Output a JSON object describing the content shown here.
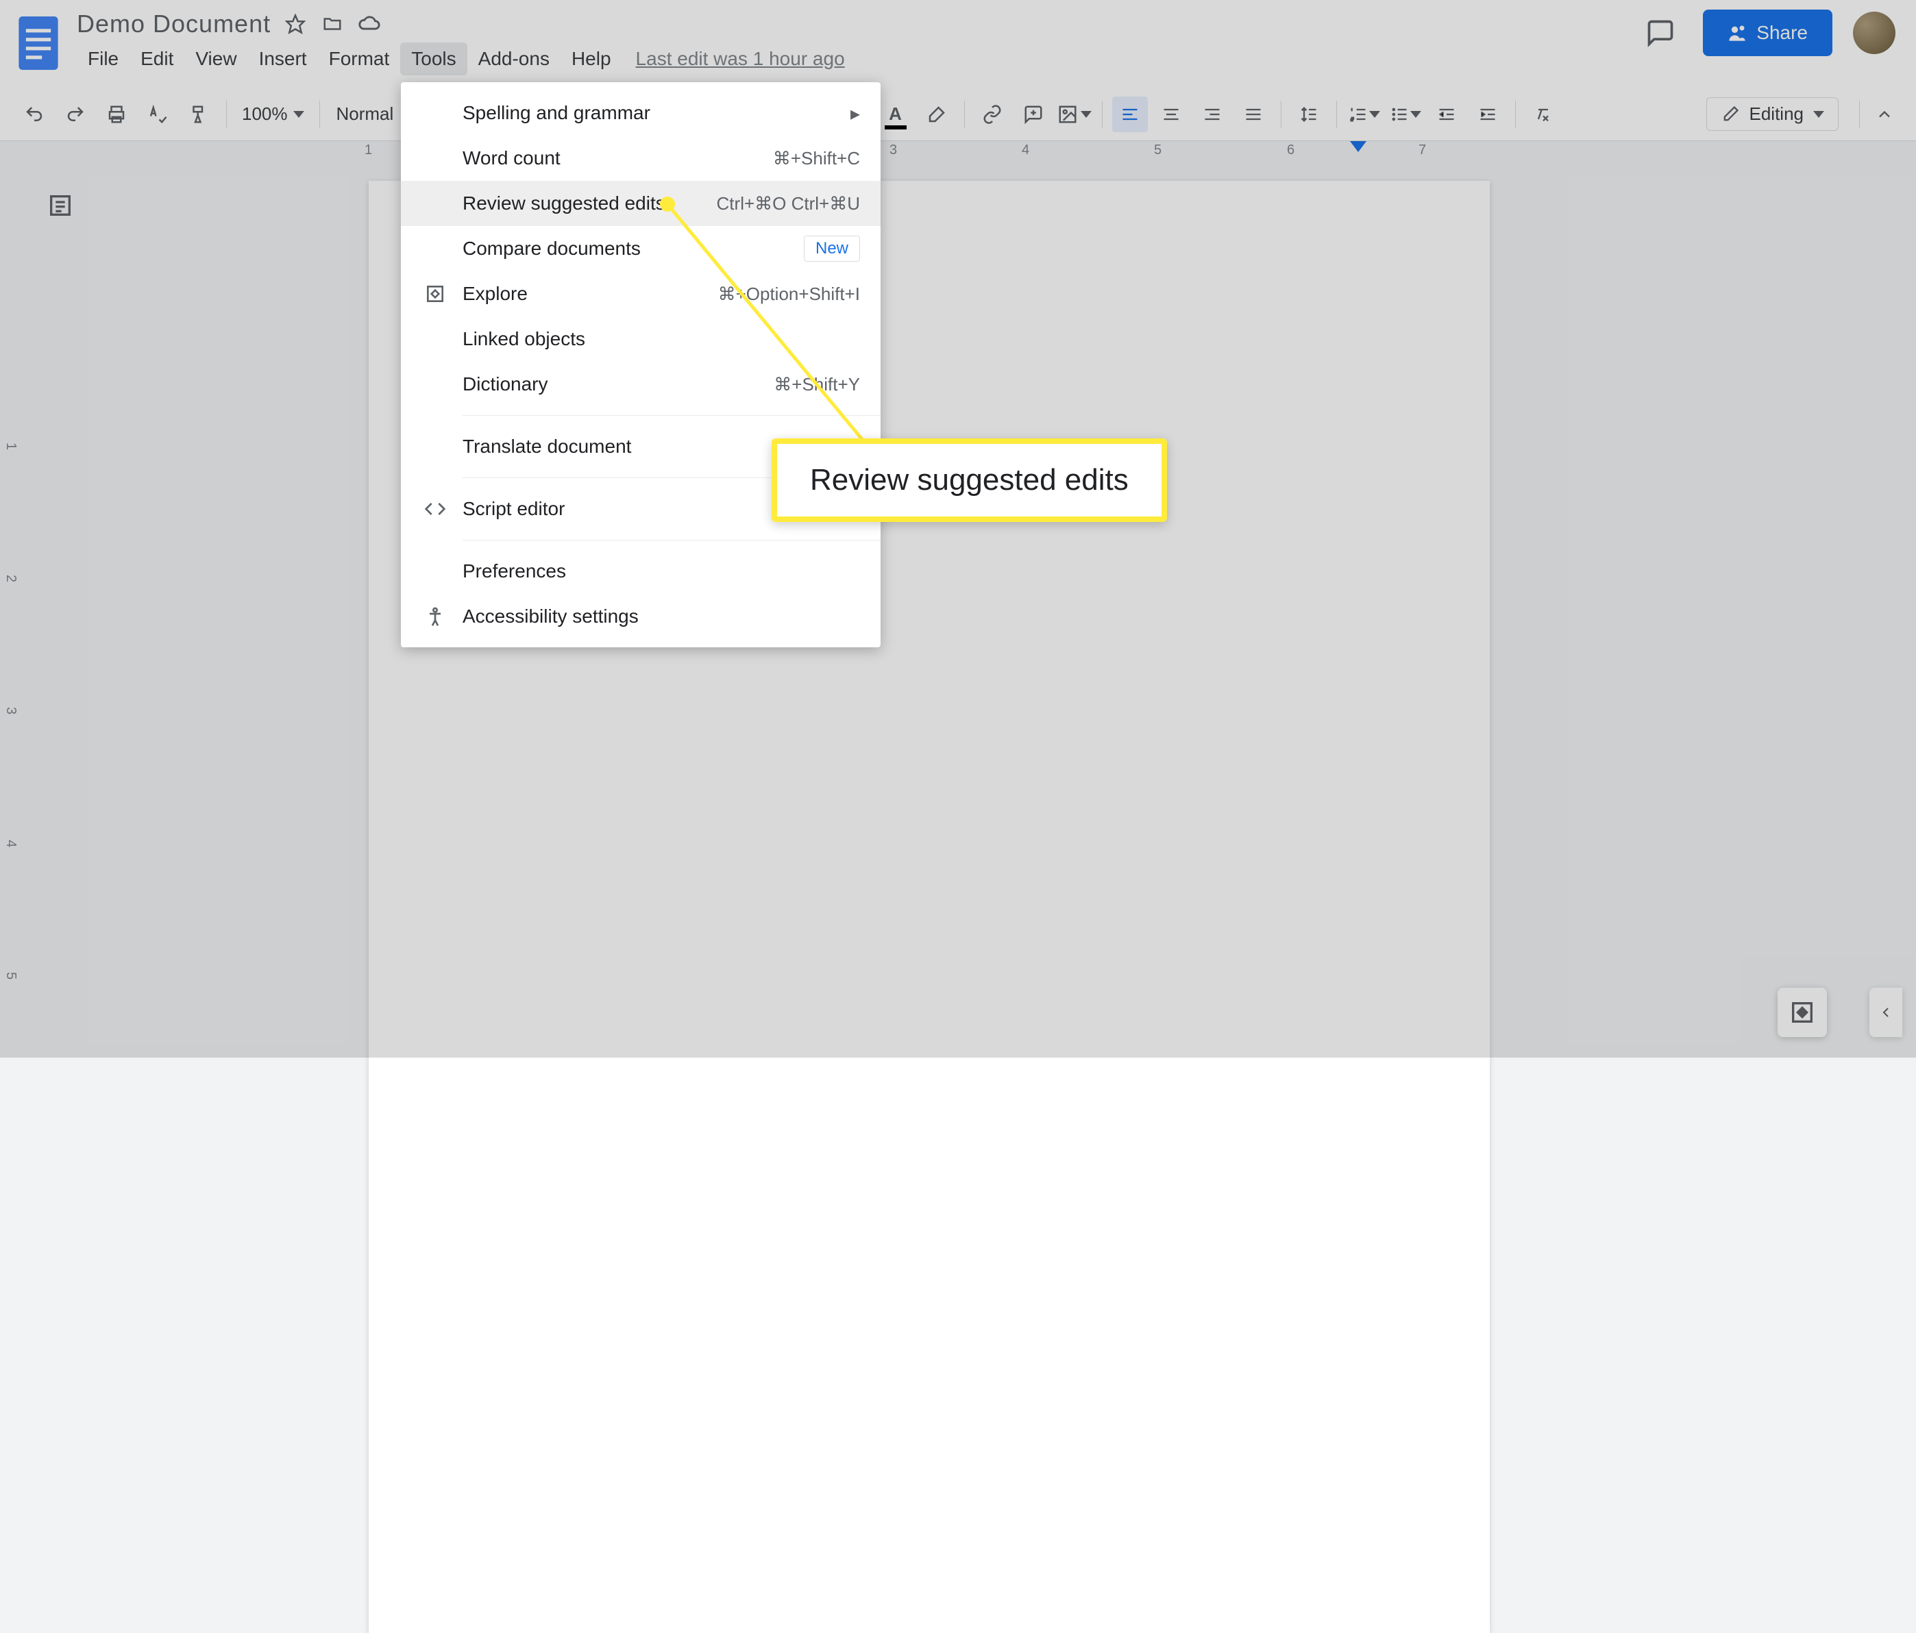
{
  "doc": {
    "title": "Demo Document",
    "last_edit": "Last edit was 1 hour ago"
  },
  "menubar": {
    "items": [
      "File",
      "Edit",
      "View",
      "Insert",
      "Format",
      "Tools",
      "Add-ons",
      "Help"
    ]
  },
  "share": {
    "label": "Share"
  },
  "toolbar": {
    "zoom": "100%",
    "style": "Normal",
    "editing": "Editing"
  },
  "tools_menu": {
    "items": [
      {
        "label": "Spelling and grammar",
        "shortcut": "",
        "submenu": true
      },
      {
        "label": "Word count",
        "shortcut": "⌘+Shift+C"
      },
      {
        "label": "Review suggested edits",
        "shortcut": "Ctrl+⌘O Ctrl+⌘U",
        "highlighted": true
      },
      {
        "label": "Compare documents",
        "badge": "New"
      },
      {
        "label": "Explore",
        "shortcut": "⌘+Option+Shift+I",
        "icon": "explore"
      },
      {
        "label": "Linked objects"
      },
      {
        "label": "Dictionary",
        "shortcut": "⌘+Shift+Y"
      },
      {
        "divider": true
      },
      {
        "label": "Translate document"
      },
      {
        "divider": true
      },
      {
        "label": "Script editor",
        "icon": "script"
      },
      {
        "divider": true
      },
      {
        "label": "Preferences"
      },
      {
        "label": "Accessibility settings",
        "icon": "accessibility"
      }
    ]
  },
  "callout": {
    "text": "Review suggested edits"
  },
  "ruler": {
    "numbers": [
      "1",
      "3",
      "4",
      "5",
      "6",
      "7"
    ]
  },
  "vruler": {
    "numbers": [
      "1",
      "2",
      "3",
      "4",
      "5"
    ]
  }
}
